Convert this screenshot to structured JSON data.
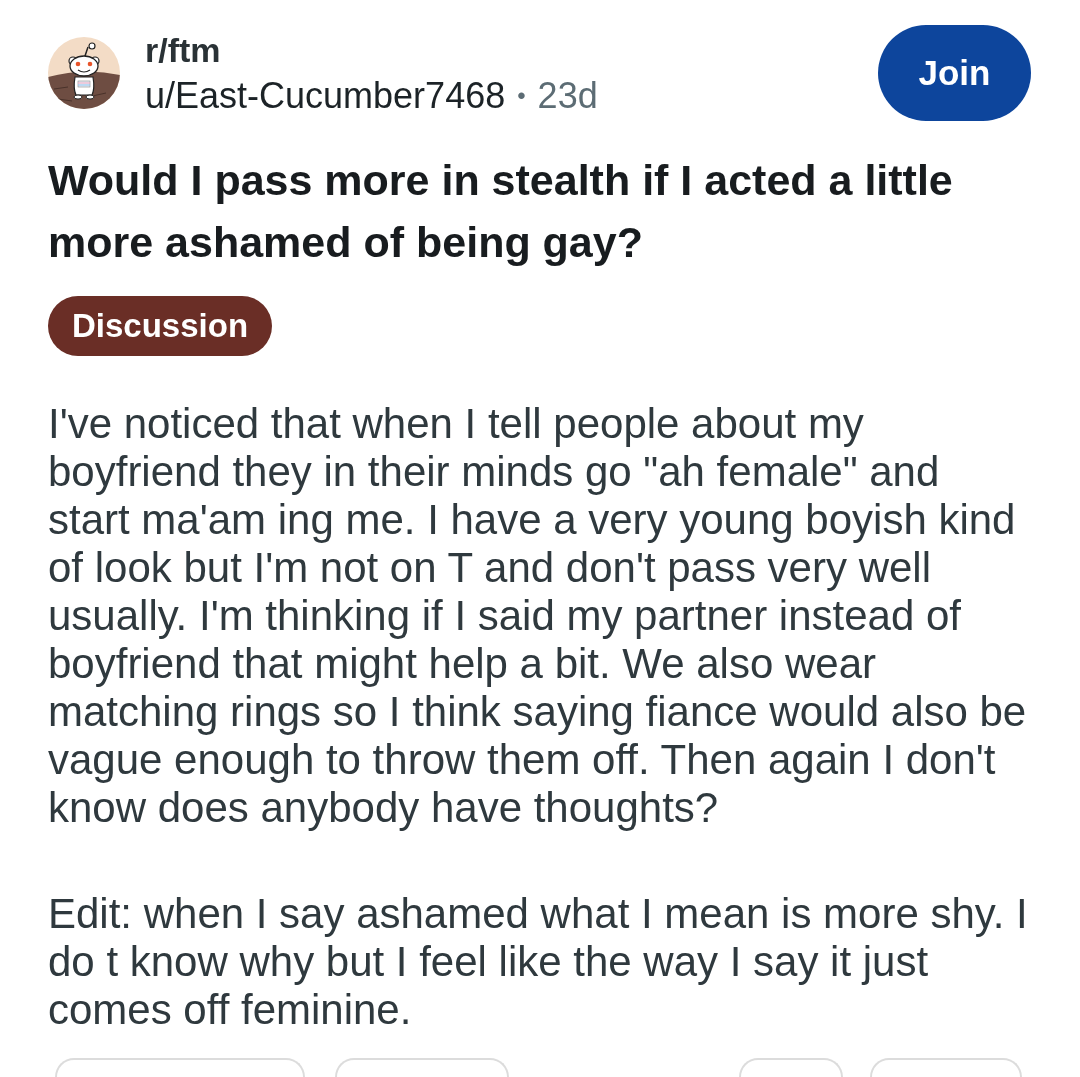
{
  "post": {
    "community": "r/ftm",
    "author": "u/East-Cucumber7468",
    "separator": "•",
    "age": "23d",
    "join_button": "Join",
    "title": "Would I pass more in stealth if I acted a little more ashamed of being gay?",
    "flair": "Discussion",
    "body": [
      "I've noticed that when I tell people about my boyfriend they in their minds go \"ah female\" and start ma'am ing me. I have a very young boyish kind of look but I'm not on T and don't pass very well usually. I'm thinking if I said my partner instead of boyfriend that might help a bit. We also wear matching rings so I think saying fiance would also be vague enough to throw them off. Then again I don't know does anybody have thoughts?",
      "Edit: when I say ashamed what I mean is more shy. I do t know why but I feel like the way I say it just comes off feminine."
    ]
  }
}
